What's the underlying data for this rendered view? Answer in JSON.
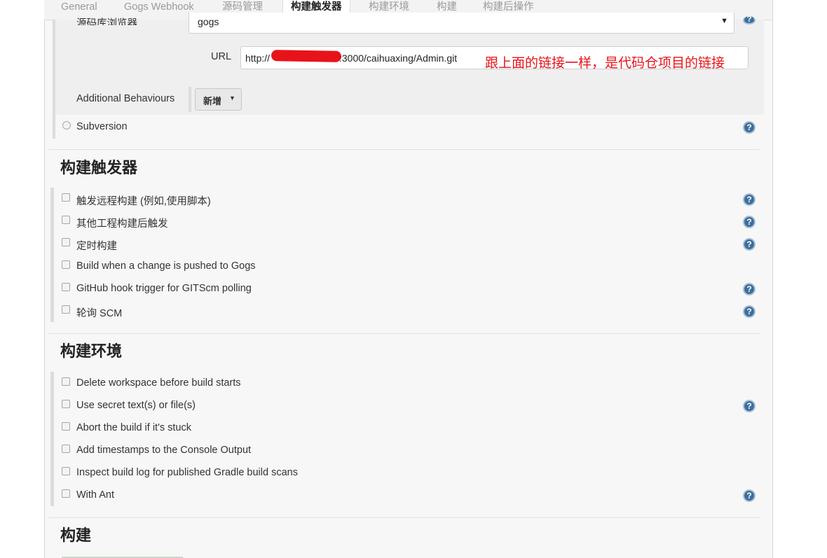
{
  "tabs": [
    {
      "label": "General"
    },
    {
      "label": "Gogs Webhook"
    },
    {
      "label": "源码管理"
    },
    {
      "label": "构建触发器"
    },
    {
      "label": "构建环境"
    },
    {
      "label": "构建"
    },
    {
      "label": "构建后操作"
    }
  ],
  "active_tab": "构建触发器",
  "scm": {
    "browser_label": "源码库浏览器",
    "browser_value": "gogs",
    "url_label": "URL",
    "url_prefix": "http://",
    "url_suffix": ":3000/caihuaxing/Admin.git",
    "annotation": "跟上面的链接一样，是代码仓项目的链接",
    "additional_behaviours_label": "Additional Behaviours",
    "add_button": "新增",
    "subversion_label": "Subversion"
  },
  "triggers": {
    "title": "构建触发器",
    "items": [
      {
        "label": "触发远程构建 (例如,使用脚本)",
        "help": true
      },
      {
        "label": "其他工程构建后触发",
        "help": true
      },
      {
        "label": "定时构建",
        "help": true
      },
      {
        "label": "Build when a change is pushed to Gogs",
        "help": false
      },
      {
        "label": "GitHub hook trigger for GITScm polling",
        "help": true
      },
      {
        "label": "轮询 SCM",
        "help": true
      }
    ]
  },
  "build_env": {
    "title": "构建环境",
    "items": [
      {
        "label": "Delete workspace before build starts",
        "help": false
      },
      {
        "label": "Use secret text(s) or file(s)",
        "help": true
      },
      {
        "label": "Abort the build if it's stuck",
        "help": false
      },
      {
        "label": "Add timestamps to the Console Output",
        "help": false
      },
      {
        "label": "Inspect build log for published Gradle build scans",
        "help": false
      },
      {
        "label": "With Ant",
        "help": true
      }
    ]
  },
  "build": {
    "title": "构建"
  },
  "help_glyph": "?",
  "icons": {
    "help": "help-icon",
    "dropdown": "caret-down-icon"
  },
  "colors": {
    "annotation": "#e8131a",
    "help": "#3d6f9d"
  }
}
